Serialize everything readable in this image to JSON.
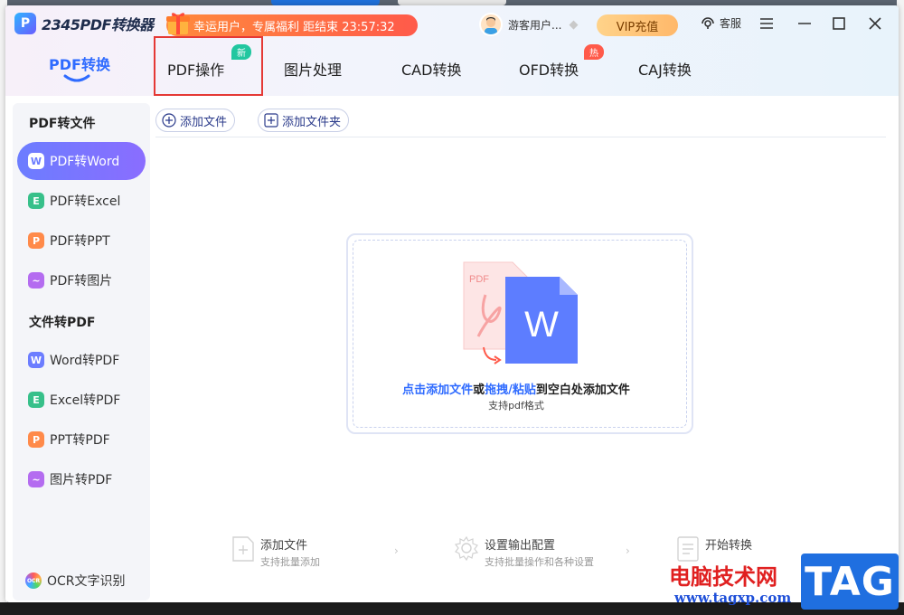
{
  "app": {
    "title": "2345PDF转换器",
    "logo_letter": "P"
  },
  "promo": {
    "text": "幸运用户，专属福利 距结束 23:57:32"
  },
  "user": {
    "name": "游客用户..."
  },
  "header": {
    "vip_label": "VIP充值",
    "service_label": "客服",
    "menu_icon": "menu-icon",
    "minimize_icon": "minimize-icon",
    "maximize_icon": "maximize-icon",
    "close_icon": "close-icon"
  },
  "nav": {
    "active": "PDF转换",
    "tabs": [
      {
        "label": "PDF操作",
        "badge": "新"
      },
      {
        "label": "图片处理",
        "badge": ""
      },
      {
        "label": "CAD转换",
        "badge": ""
      },
      {
        "label": "OFD转换",
        "badge": "热"
      },
      {
        "label": "CAJ转换",
        "badge": ""
      }
    ]
  },
  "sidebar": {
    "section1": "PDF转文件",
    "section2": "文件转PDF",
    "items": [
      {
        "label": "PDF转Word",
        "icon": "W",
        "color": "#6c7dff"
      },
      {
        "label": "PDF转Excel",
        "icon": "E",
        "color": "#37c08a"
      },
      {
        "label": "PDF转PPT",
        "icon": "P",
        "color": "#ff8a4a"
      },
      {
        "label": "PDF转图片",
        "icon": "~",
        "color": "#b46cf0"
      },
      {
        "label": "Word转PDF",
        "icon": "W",
        "color": "#6c7dff"
      },
      {
        "label": "Excel转PDF",
        "icon": "E",
        "color": "#37c08a"
      },
      {
        "label": "PPT转PDF",
        "icon": "P",
        "color": "#ff8a4a"
      },
      {
        "label": "图片转PDF",
        "icon": "~",
        "color": "#b46cf0"
      }
    ],
    "ocr_label": "OCR文字识别",
    "ocr_icon_text": "OCR"
  },
  "toolbar": {
    "add_file": "添加文件",
    "add_folder": "添加文件夹"
  },
  "dropzone": {
    "pdf_tag": "PDF",
    "word_letter": "W",
    "line1_a": "点击添加文件",
    "line1_b": "或",
    "line1_c": "拖拽/粘贴",
    "line1_d": "到空白处添加文件",
    "line2": "支持pdf格式"
  },
  "steps": [
    {
      "title": "添加文件",
      "sub": "支持批量添加"
    },
    {
      "title": "设置输出配置",
      "sub": "支持批量操作和各种设置"
    },
    {
      "title": "开始转换",
      "sub": ""
    }
  ],
  "watermark": {
    "text": "电脑技术网",
    "url": "www.tagxp.com",
    "tag": "TAG"
  },
  "colors": {
    "accent": "#2f6bff",
    "highlight_border": "#e53935",
    "badge_new": "#22c7a0",
    "badge_hot": "#ff5a4a"
  }
}
